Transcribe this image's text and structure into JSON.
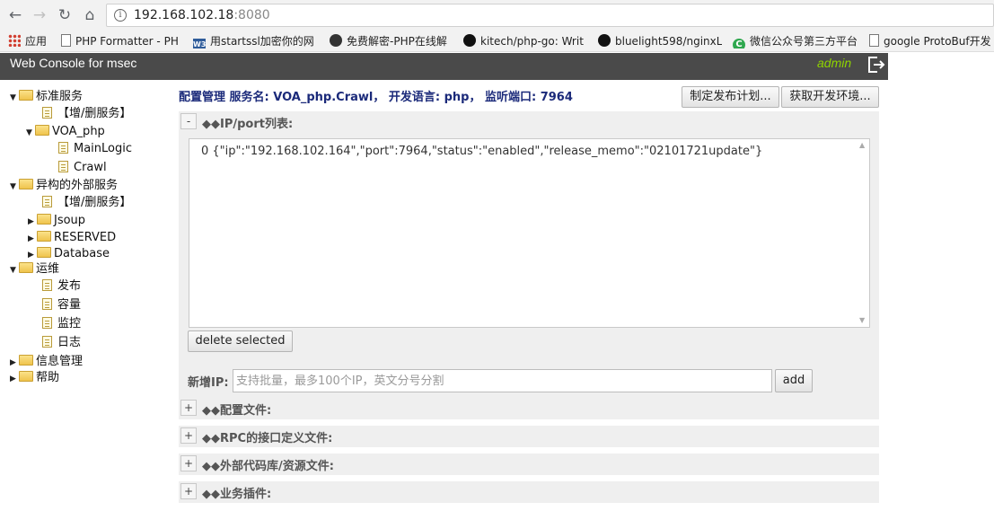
{
  "browser": {
    "url_host": "192.168.102.18",
    "url_port": ":8080",
    "bookmarks": [
      {
        "icon": "apps-icon",
        "label": "应用"
      },
      {
        "icon": "page-icon",
        "label": "PHP Formatter - PH"
      },
      {
        "icon": "w3-icon",
        "label": "用startssl加密你的网"
      },
      {
        "icon": "round-icon",
        "label": "免费解密-PHP在线解"
      },
      {
        "icon": "github-icon",
        "label": "kitech/php-go: Writ"
      },
      {
        "icon": "github-icon",
        "label": "bluelight598/nginxL"
      },
      {
        "icon": "green-c-icon",
        "label": "微信公众号第三方平台"
      },
      {
        "icon": "page-icon",
        "label": "google ProtoBuf开发"
      }
    ]
  },
  "header": {
    "title": "Web Console for msec",
    "user": "admin"
  },
  "sidebar": {
    "std_service": "标准服务",
    "std_add_remove": "【增/删服务】",
    "voa_php": "VOA_php",
    "mainlogic": "MainLogic",
    "crawl": "Crawl",
    "ext_service": "异构的外部服务",
    "ext_add_remove": "【增/删服务】",
    "jsoup": "Jsoup",
    "reserved": "RESERVED",
    "database": "Database",
    "ops": "运维",
    "publish": "发布",
    "capacity": "容量",
    "monitor": "监控",
    "log": "日志",
    "info_mgmt": "信息管理",
    "help": "帮助"
  },
  "main": {
    "breadcrumb": "配置管理  服务名: VOA_php.Crawl， 开发语言: php， 监听端口: 7964",
    "plan_button": "制定发布计划...",
    "env_button": "获取开发环境...",
    "ip_section": {
      "toggle": "-",
      "title": "◆◆IP/port列表:",
      "items": [
        "0 {\"ip\":\"192.168.102.164\",\"port\":7964,\"status\":\"enabled\",\"release_memo\":\"02101721update\"}"
      ],
      "delete_button": "delete selected",
      "add_label": "新增IP:",
      "add_placeholder": "支持批量，最多100个IP，英文分号分割",
      "add_button": "add"
    },
    "sections": [
      {
        "toggle": "+",
        "title": "◆◆配置文件:"
      },
      {
        "toggle": "+",
        "title": "◆◆RPC的接口定义文件:"
      },
      {
        "toggle": "+",
        "title": "◆◆外部代码库/资源文件:"
      },
      {
        "toggle": "+",
        "title": "◆◆业务插件:"
      }
    ]
  }
}
